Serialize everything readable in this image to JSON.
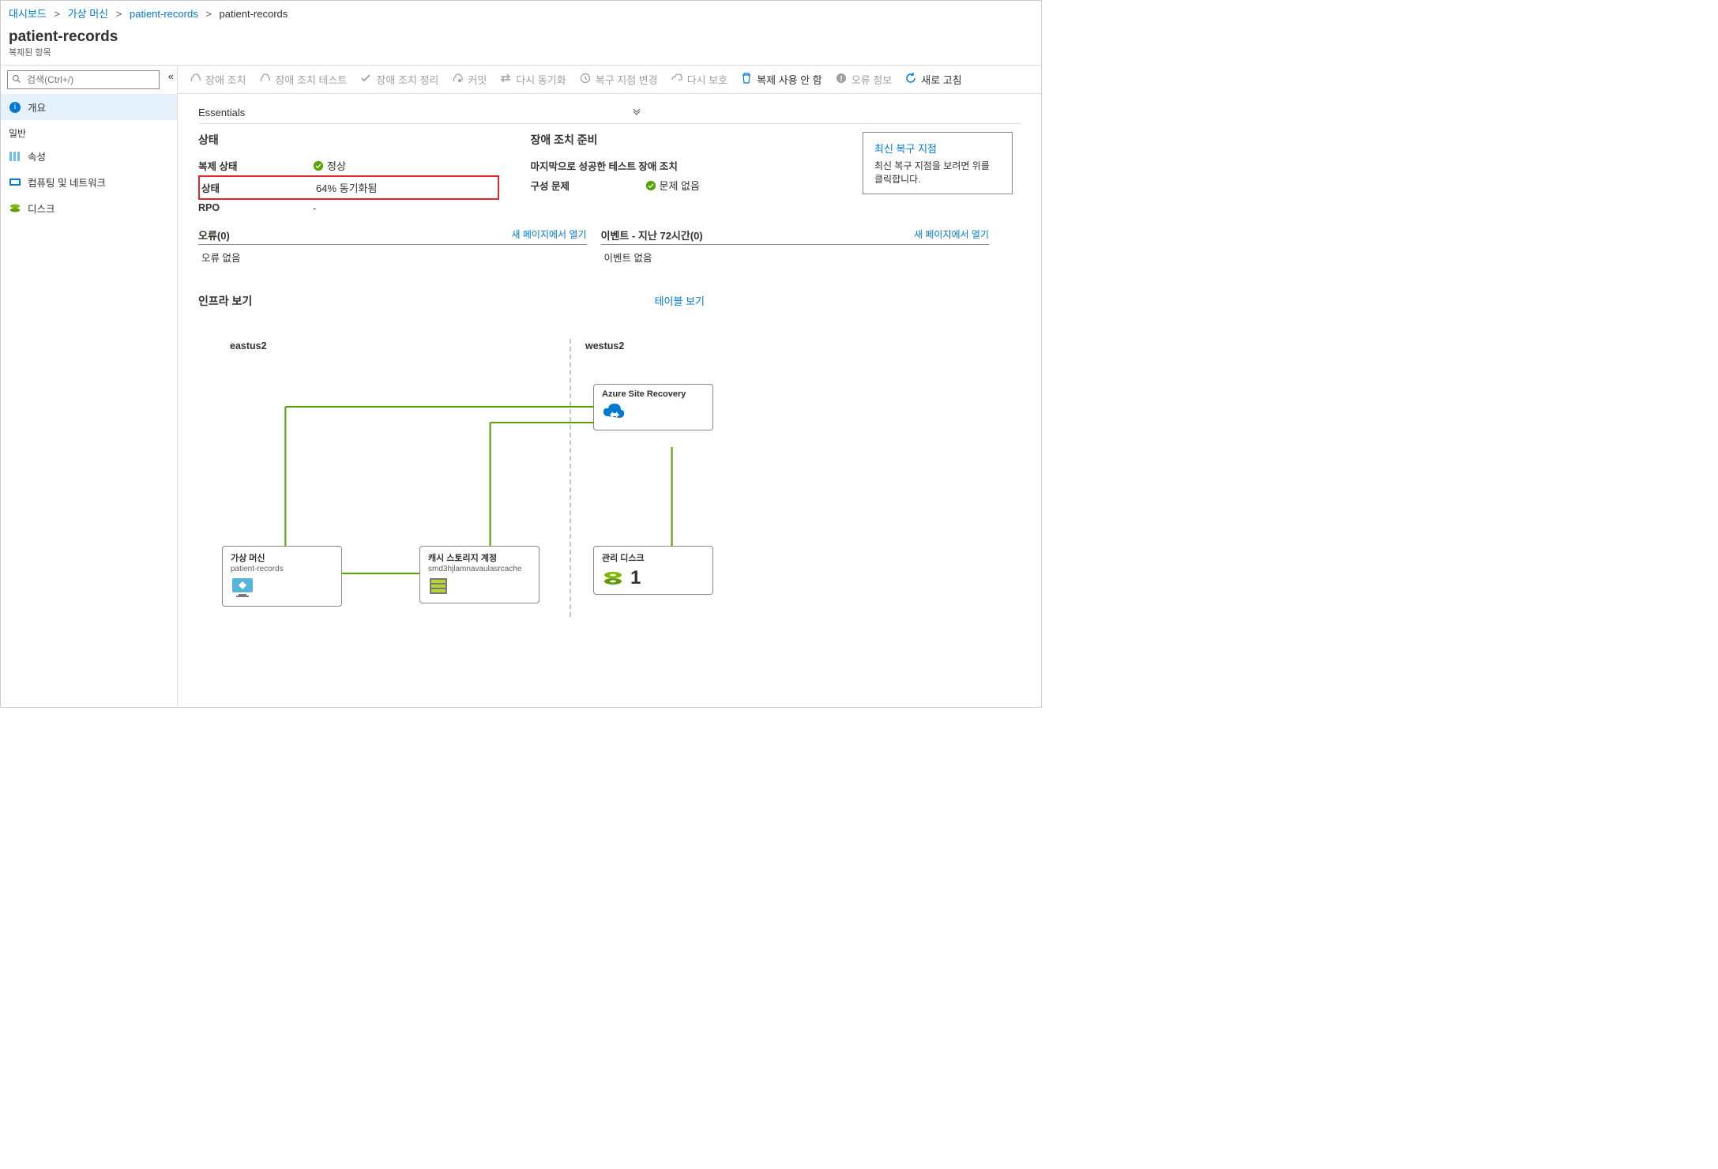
{
  "breadcrumb": {
    "items": [
      {
        "label": "대시보드",
        "link": true
      },
      {
        "label": "가상 머신",
        "link": true
      },
      {
        "label": "patient-records",
        "link": true
      },
      {
        "label": "patient-records",
        "link": false
      }
    ]
  },
  "header": {
    "title": "patient-records",
    "subtitle": "복제된 항목"
  },
  "search": {
    "placeholder": "검색(Ctrl+/)"
  },
  "nav": {
    "overview": "개요",
    "section_general": "일반",
    "properties": "속성",
    "compute_network": "컴퓨팅 및 네트워크",
    "disks": "디스크"
  },
  "toolbar": {
    "failover": "장애 조치",
    "test_failover": "장애 조치 테스트",
    "cleanup": "장애 조치 정리",
    "commit": "커밋",
    "resync": "다시 동기화",
    "change_rp": "복구 지점 변경",
    "reprotect": "다시 보호",
    "disable_repl": "복제 사용 안 함",
    "error_details": "오류 정보",
    "refresh": "새로 고침"
  },
  "essentials": {
    "title": "Essentials",
    "status": {
      "heading": "상태",
      "repl_status_label": "복제 상태",
      "repl_status_value": "정상",
      "status_label": "상태",
      "status_value": "64% 동기화됨",
      "rpo_label": "RPO",
      "rpo_value": "-"
    },
    "failover": {
      "heading": "장애 조치 준비",
      "last_success_label": "마지막으로 성공한 테스트 장애 조치",
      "config_label": "구성 문제",
      "config_value": "문제 없음"
    },
    "recovery_card": {
      "title": "최신 복구 지점",
      "text": "최신 복구 지점을 보려면 위를 클릭합니다."
    },
    "errors": {
      "title": "오류(0)",
      "link": "새 페이지에서 열기",
      "body": "오류 없음"
    },
    "events": {
      "title": "이벤트 - 지난 72시간(0)",
      "link": "새 페이지에서 열기",
      "body": "이벤트 없음"
    }
  },
  "infra": {
    "title": "인프라 보기",
    "link": "테이블 보기",
    "region_left": "eastus2",
    "region_right": "westus2",
    "nodes": {
      "asr": {
        "title": "Azure Site Recovery"
      },
      "vm": {
        "title": "가상 머신",
        "sub": "patient-records"
      },
      "storage": {
        "title": "캐시 스토리지 계정",
        "sub": "smd3hjlamnavaulasrcache"
      },
      "disk": {
        "title": "관리 디스크",
        "count": "1"
      }
    }
  }
}
